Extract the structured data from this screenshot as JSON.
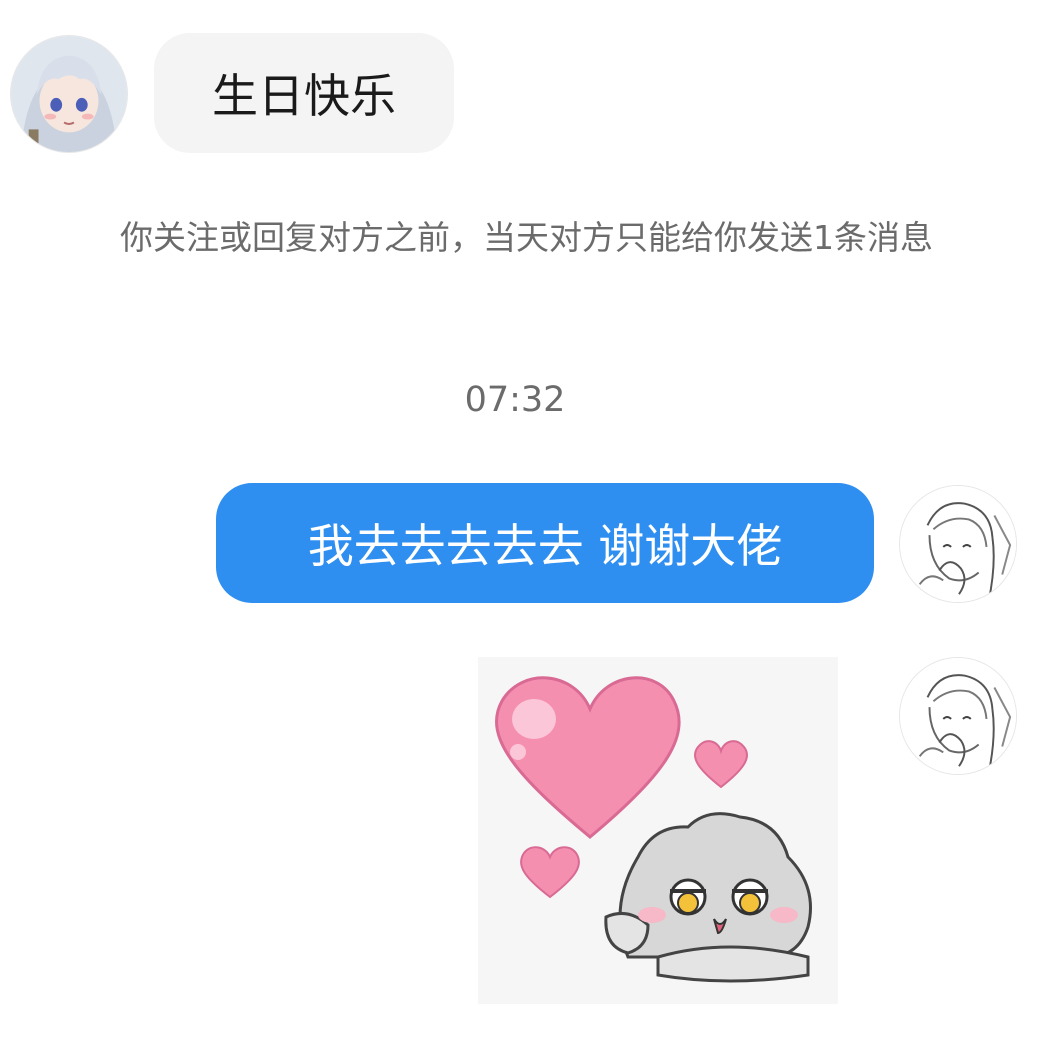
{
  "messages": {
    "incoming": {
      "avatar_icon": "anime-girl-avatar-icon",
      "text": "生日快乐"
    },
    "system_notice": "你关注或回复对方之前，当天对方只能给你发送1条消息",
    "timestamp": "07:32",
    "outgoing_text": {
      "avatar_icon": "sketch-girl-avatar-icon",
      "text": "我去去去去去 谢谢大佬"
    },
    "outgoing_sticker": {
      "avatar_icon": "sketch-girl-avatar-icon",
      "sticker_icon": "heart-bunny-sticker-icon"
    }
  },
  "colors": {
    "outgoing_bubble": "#2f8ff0",
    "incoming_bubble": "#f4f4f5",
    "meta_text": "#6b6b6b"
  }
}
